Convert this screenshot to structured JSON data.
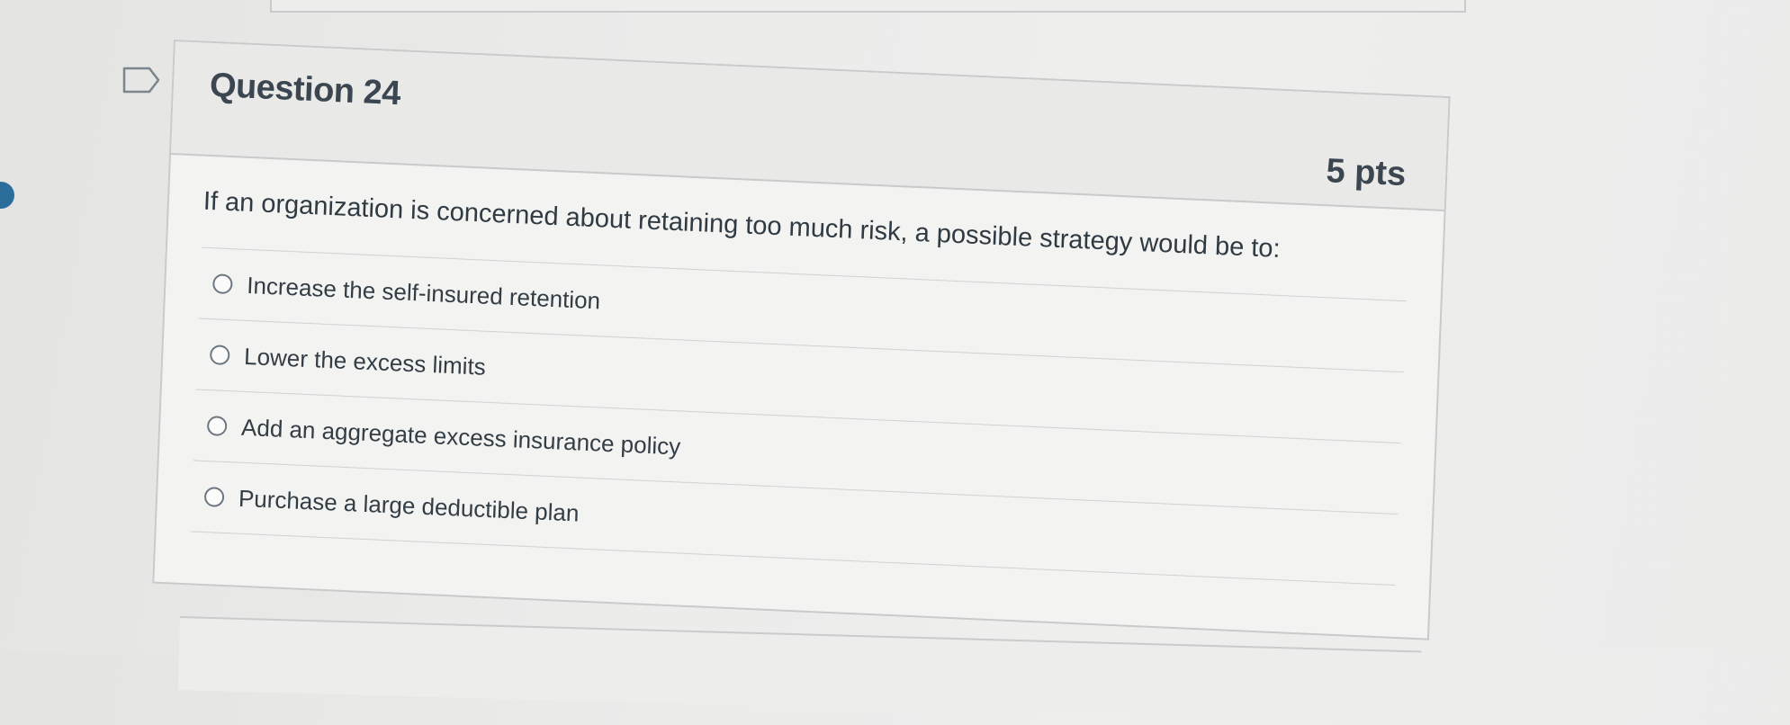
{
  "question": {
    "title": "Question 24",
    "points": "5 pts",
    "text": "If an organization is concerned about retaining too much risk, a possible strategy would be to:",
    "answers": [
      {
        "label": "Increase the self-insured retention",
        "selected": false
      },
      {
        "label": "Lower the excess limits",
        "selected": false
      },
      {
        "label": "Add an aggregate excess insurance policy",
        "selected": false
      },
      {
        "label": "Purchase a large deductible plan",
        "selected": false
      }
    ]
  },
  "icons": {
    "flag": "flag-question-icon",
    "nav_dot": "question-nav-indicator"
  },
  "colors": {
    "nav_dot": "#2b6e9b",
    "card_header": "#e9e9e8",
    "card_body": "#f3f3f2",
    "border": "#c8cacb",
    "text": "#2f3a42"
  }
}
